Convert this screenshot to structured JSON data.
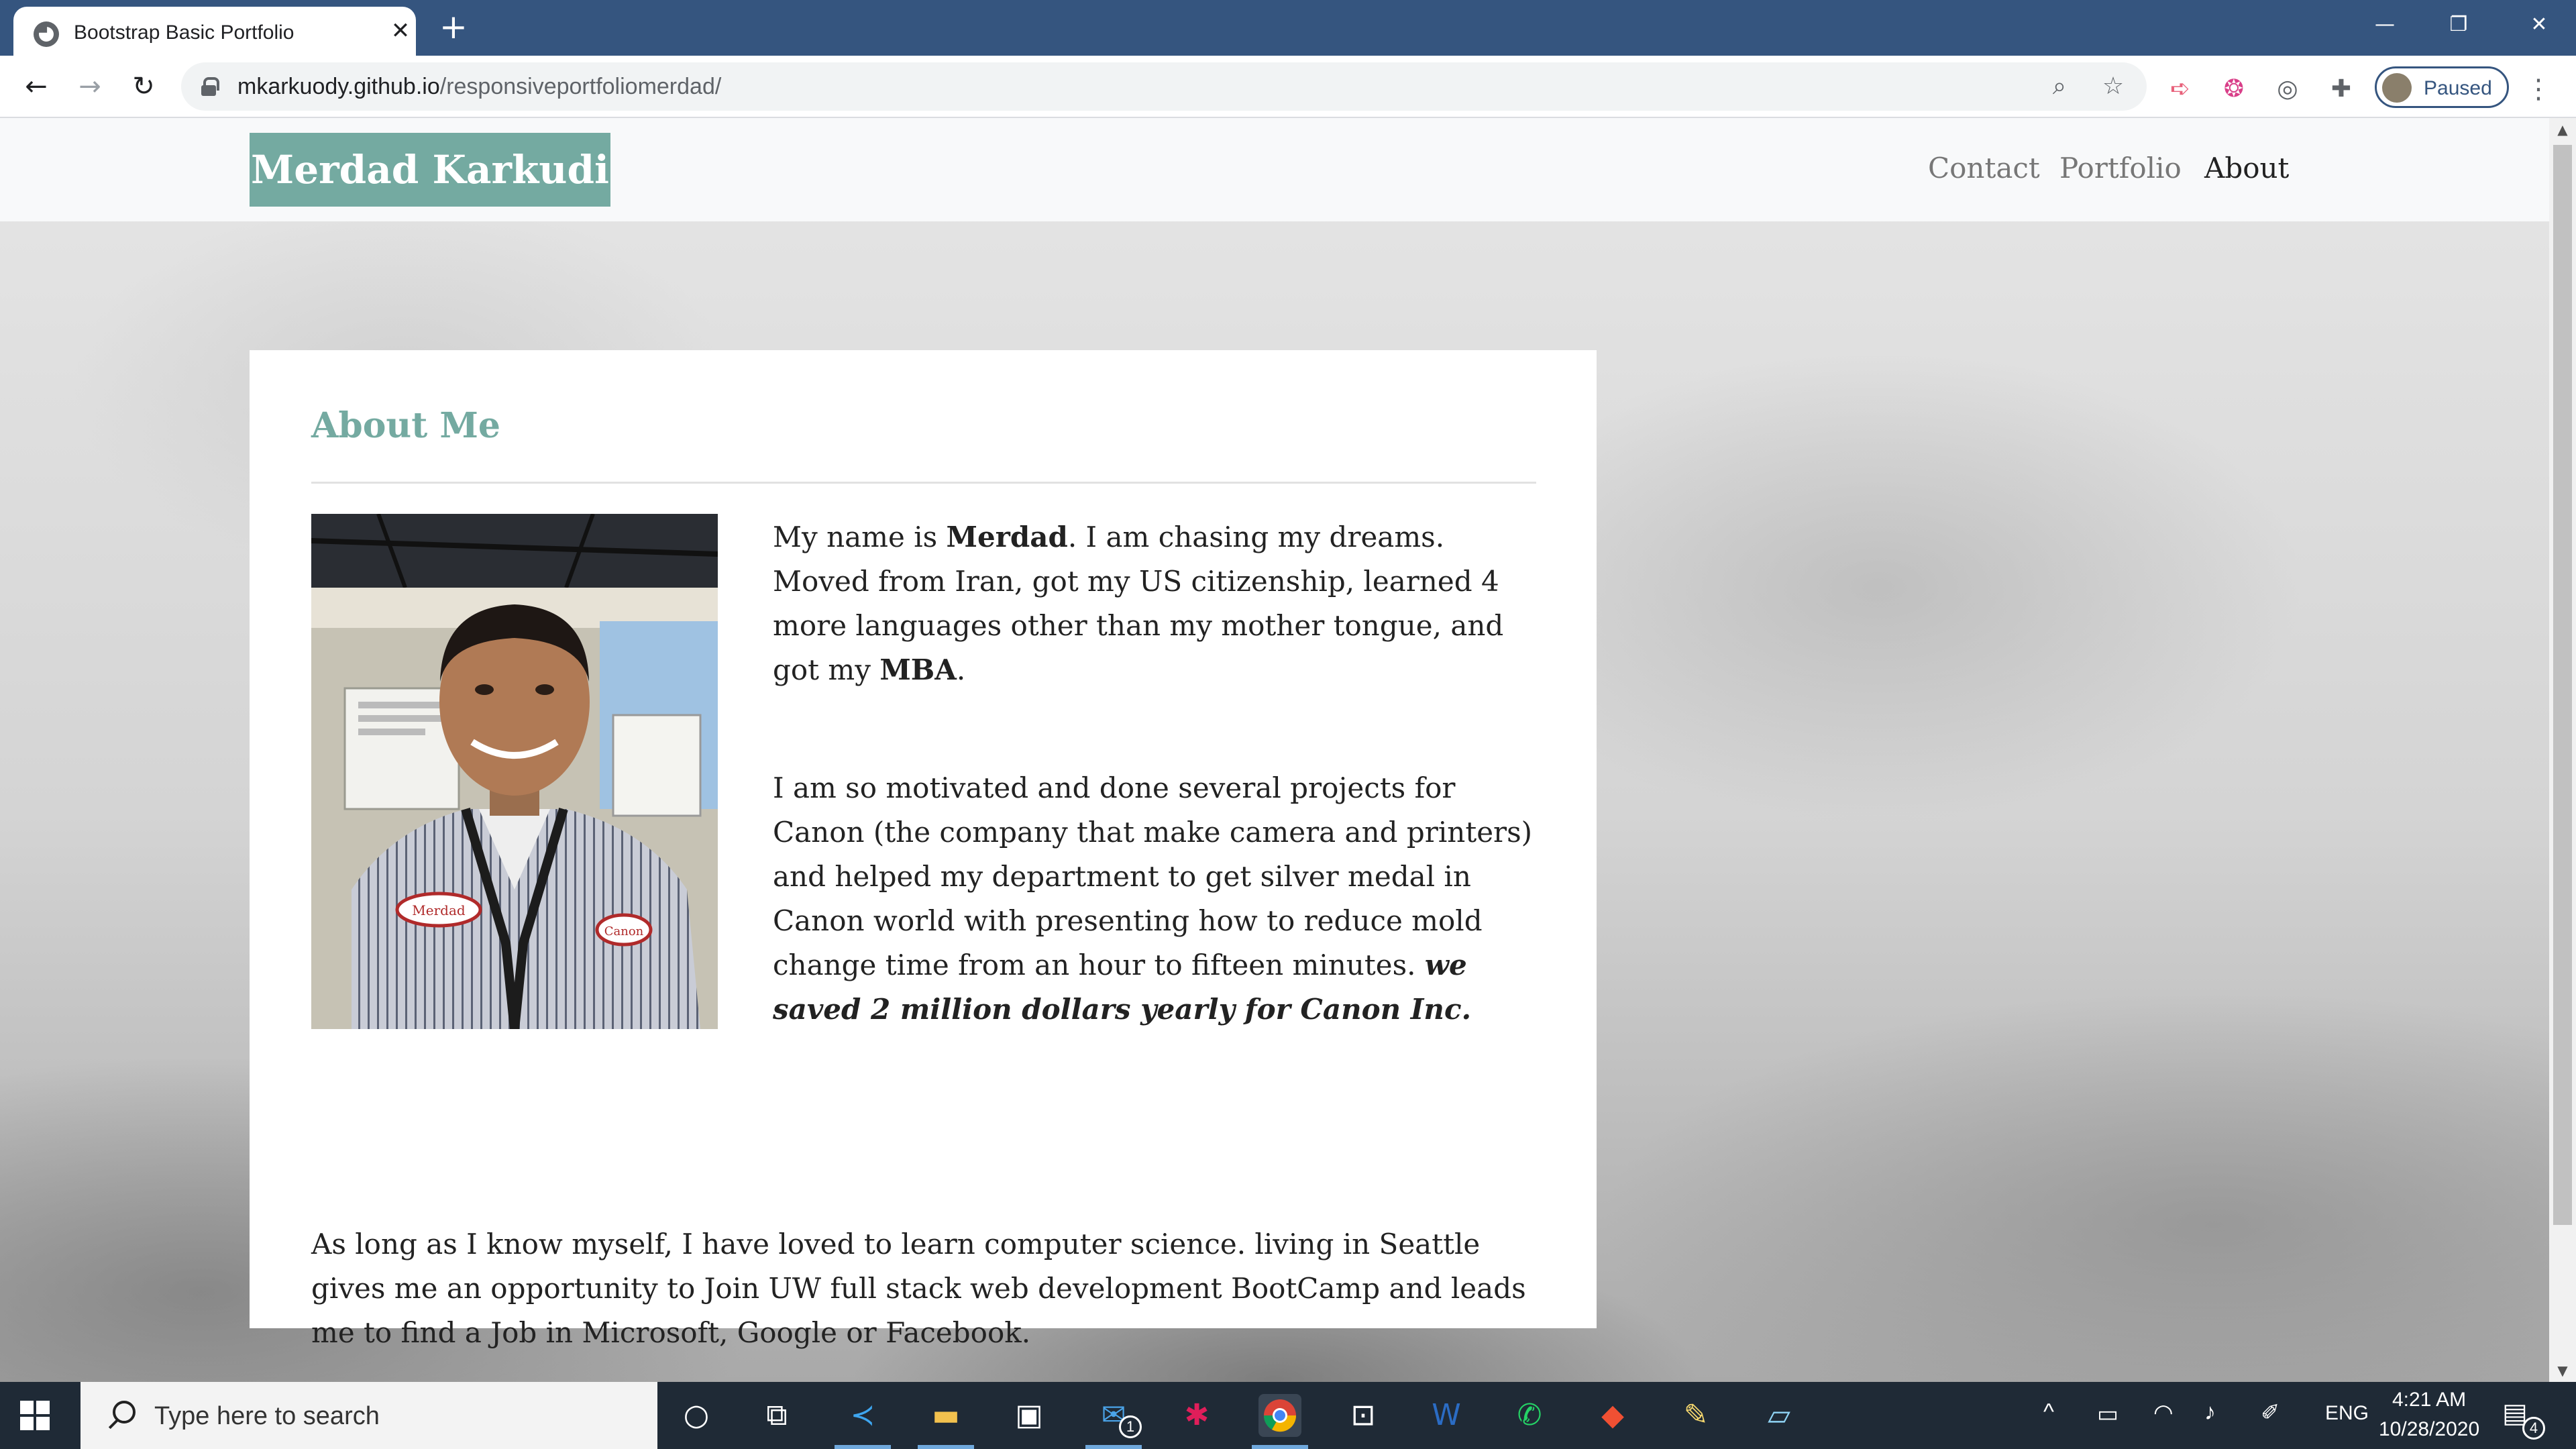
{
  "browser": {
    "tab_title": "Bootstrap Basic Portfolio",
    "url_host": "mkarkuody.github.io",
    "url_path": "/responsiveportfoliomerdad/",
    "profile_label": "Paused",
    "colors": {
      "frame": "#35557f",
      "toolbar": "#ffffff",
      "omnibox": "#f1f3f4"
    }
  },
  "site": {
    "brand": "Merdad Karkudi",
    "nav": [
      {
        "label": "Contact",
        "active": false
      },
      {
        "label": "Portfolio",
        "active": false
      },
      {
        "label": "About",
        "active": true
      }
    ],
    "accent_color": "#74aaa1"
  },
  "about": {
    "title": "About Me",
    "p1": {
      "t1": "My name is ",
      "name": "Merdad",
      "t2": ". I am chasing my dreams. Moved from Iran, got my US citizenship, learned 4 more languages other than my mother tongue, and got my ",
      "degree": "MBA",
      "t3": "."
    },
    "p2": {
      "t1": "I am so motivated and done several projects for Canon (the company that make camera and printers) and helped my department to get silver medal in Canon world with presenting how to reduce mold change time from an hour to fifteen minutes. ",
      "emphasis": "we saved 2 million dollars yearly for Canon Inc."
    },
    "p3": "As long as I know myself, I have loved to learn computer science. living in Seattle gives me an opportunity to Join UW full stack web development BootCamp and leads me to find a Job in Microsoft, Google or Facebook.",
    "photo_badge_left": "Merdad",
    "photo_badge_right": "Canon"
  },
  "taskbar": {
    "search_placeholder": "Type here to search",
    "mail_badge": "1",
    "language": "ENG",
    "time": "4:21 AM",
    "date": "10/28/2020",
    "notification_count": "4",
    "apps": [
      "cortana-icon",
      "task-view-icon",
      "vscode-icon",
      "file-explorer-icon",
      "store-icon",
      "mail-icon",
      "slack-icon",
      "chrome-icon",
      "app-icon",
      "word-icon",
      "whatsapp-icon",
      "git-icon",
      "paint-icon",
      "notes-icon"
    ]
  }
}
